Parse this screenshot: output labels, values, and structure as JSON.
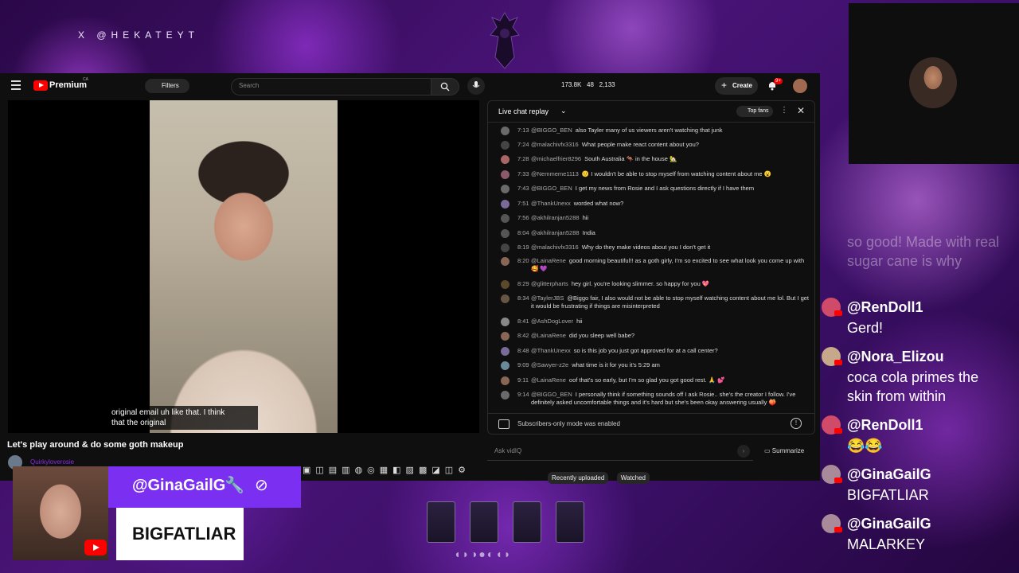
{
  "overlay": {
    "x_handle": "X @HEKATEYT"
  },
  "youtube": {
    "logo": "Premium",
    "logo_region": "CA",
    "filters_label": "Filters",
    "search_placeholder": "Search",
    "stats": [
      "173.8K",
      "48",
      "2,133"
    ],
    "create_label": "Create",
    "notif_count": "9+",
    "video_caption": [
      "original email uh like that. I think",
      "that the original"
    ],
    "video_title": "Let's play around & do some goth makeup",
    "channel_name": "Quirkyloverosie",
    "ask_placeholder": "Ask vidIQ",
    "summarize_label": "Summarize",
    "chips": [
      "Recently uploaded",
      "Watched"
    ]
  },
  "chat": {
    "title": "Live chat replay",
    "top_fans": "Top fans",
    "footer_notice": "Subscribers-only mode was enabled",
    "messages": [
      {
        "ts": "7:13",
        "author": "@BIGGO_BEN",
        "text": "also Tayler many of us viewers aren't watching that junk"
      },
      {
        "ts": "7:24",
        "author": "@malachivfx3316",
        "text": "What people make react content about you?"
      },
      {
        "ts": "7:28",
        "author": "@michaelfrier8296",
        "text": "South Australia 🦘 in the house 🏡"
      },
      {
        "ts": "7:33",
        "author": "@Nemmeme1113",
        "text": "🙂 I wouldn't be able to stop myself from watching content about me 😮"
      },
      {
        "ts": "7:43",
        "author": "@BIGGO_BEN",
        "text": "I get my news from Rosie and I ask questions directly if I have them"
      },
      {
        "ts": "7:51",
        "author": "@ThankUnexx",
        "text": "worded what now?"
      },
      {
        "ts": "7:56",
        "author": "@akhilranjan5288",
        "text": "hii"
      },
      {
        "ts": "8:04",
        "author": "@akhilranjan5288",
        "text": "India"
      },
      {
        "ts": "8:19",
        "author": "@malachivfx3316",
        "text": "Why do they make videos about you I don't get it"
      },
      {
        "ts": "8:20",
        "author": "@LainaRene",
        "text": "good morning beautiful!! as a goth girly, I'm so excited to see what look you come up with 🥰 💜"
      },
      {
        "ts": "8:29",
        "author": "@glitterpharts",
        "text": "hey girl. you're looking slimmer. so happy for you 💖"
      },
      {
        "ts": "8:34",
        "author": "@TaylerJBS",
        "text": "@Biggo fair, I also would not be able to stop myself watching content about me lol. But I get it would be frustrating if things are misinterpreted"
      },
      {
        "ts": "8:41",
        "author": "@AshDogLover",
        "text": "hii"
      },
      {
        "ts": "8:42",
        "author": "@LainaRene",
        "text": "did you sleep well babe?"
      },
      {
        "ts": "8:48",
        "author": "@ThankUnexx",
        "text": "so is this job you just got approved for at a call center?"
      },
      {
        "ts": "9:09",
        "author": "@Sawyer-z2e",
        "text": "what time is it for you it's 5:29 am"
      },
      {
        "ts": "9:11",
        "author": "@LainaRene",
        "text": "oof that's so early, but I'm so glad you got good rest. 🙏 💕"
      },
      {
        "ts": "9:14",
        "author": "@BIGGO_BEN",
        "text": "I personally think if something sounds off I ask Rosie.. she's the creator I follow. I've definitely asked uncomfortable things and it's hard but she's been okay answering usually 🍑"
      }
    ]
  },
  "stream_chat": {
    "partial": "so good! Made with real sugar cane is why",
    "items": [
      {
        "name": "@RenDoll1",
        "text": "Gerd!"
      },
      {
        "name": "@Nora_Elizou",
        "text": "coca cola primes the skin from within"
      },
      {
        "name": "@RenDoll1",
        "text": "😂😂"
      },
      {
        "name": "@GinaGailG",
        "text": "BIGFATLIAR"
      },
      {
        "name": "@GinaGailG",
        "text": "MALARKEY"
      }
    ]
  },
  "alert": {
    "name": "@GinaGailG",
    "message": "BIGFATLIAR"
  }
}
